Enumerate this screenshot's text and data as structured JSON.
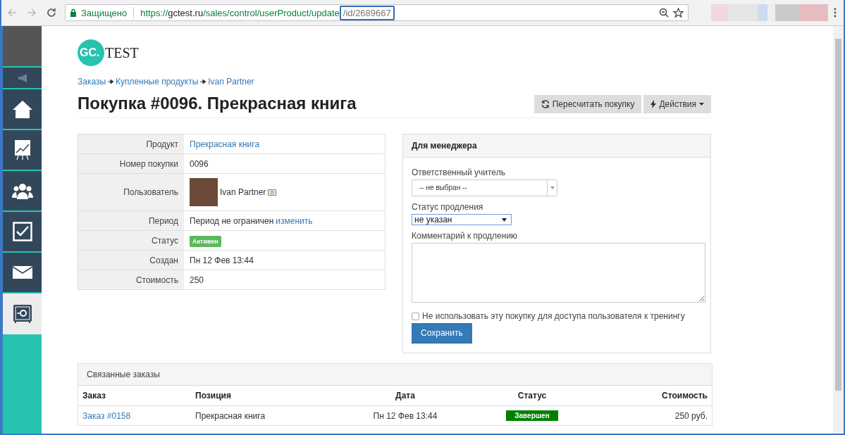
{
  "browser": {
    "secure_label": "Защищено",
    "url_scheme": "https://",
    "url_host": "gctest.ru",
    "url_path": "/sales/control/userProduct/update",
    "url_highlight": "/id/2689667"
  },
  "sidebar": {
    "items": [
      {
        "kind": "sound",
        "selected": false
      },
      {
        "kind": "home",
        "selected": false
      },
      {
        "kind": "chart",
        "selected": false
      },
      {
        "kind": "users",
        "selected": false
      },
      {
        "kind": "tasks",
        "selected": false
      },
      {
        "kind": "mail",
        "selected": false
      },
      {
        "kind": "safe",
        "selected": true
      }
    ]
  },
  "logo": {
    "mark": "GC.",
    "word": "TEST"
  },
  "breadcrumbs": [
    "Заказы",
    "Купленные продукты",
    "Ivan Partner"
  ],
  "page_title": "Покупка #0096. Прекрасная книга",
  "actions": [
    {
      "label": "Пересчитать покупку",
      "kind": "refresh"
    },
    {
      "label": "Действия",
      "kind": "dropdown"
    }
  ],
  "details": [
    {
      "label": "Продукт",
      "kind": "link",
      "value": "Прекрасная книга"
    },
    {
      "label": "Номер покупки",
      "kind": "text",
      "value": "0096"
    },
    {
      "label": "Пользователь",
      "kind": "user",
      "value": "Ivan Partner"
    },
    {
      "label": "Период",
      "kind": "period",
      "value": "Период не ограничен",
      "link": "изменить"
    },
    {
      "label": "Статус",
      "kind": "badge",
      "value": "Активен",
      "color": "#5cb85c"
    },
    {
      "label": "Создан",
      "kind": "text",
      "value": "Пн 12 Фев 13:44"
    },
    {
      "label": "Стоимость",
      "kind": "text",
      "value": "250"
    }
  ],
  "manager": {
    "title": "Для менеджера",
    "teacher_label": "Ответственный учитель",
    "teacher_value": "-- не выбран --",
    "renewal_label": "Статус продления",
    "renewal_value": "не указан",
    "comment_label": "Комментарий к продлению",
    "no_access_label": "Не использовать эту покупку для доступа пользователя к тренингу",
    "no_access_checked": false,
    "save": "Сохранить"
  },
  "related": {
    "title": "Связанные заказы",
    "columns": [
      "Заказ",
      "Позиция",
      "Дата",
      "Статус",
      "Стоимость"
    ],
    "rows": [
      {
        "order": "Заказ #0158",
        "item": "Прекрасная книга",
        "date": "Пн 12 Фев 13:44",
        "status": "Завершен",
        "color": "#008000",
        "price": "250 руб."
      }
    ]
  }
}
